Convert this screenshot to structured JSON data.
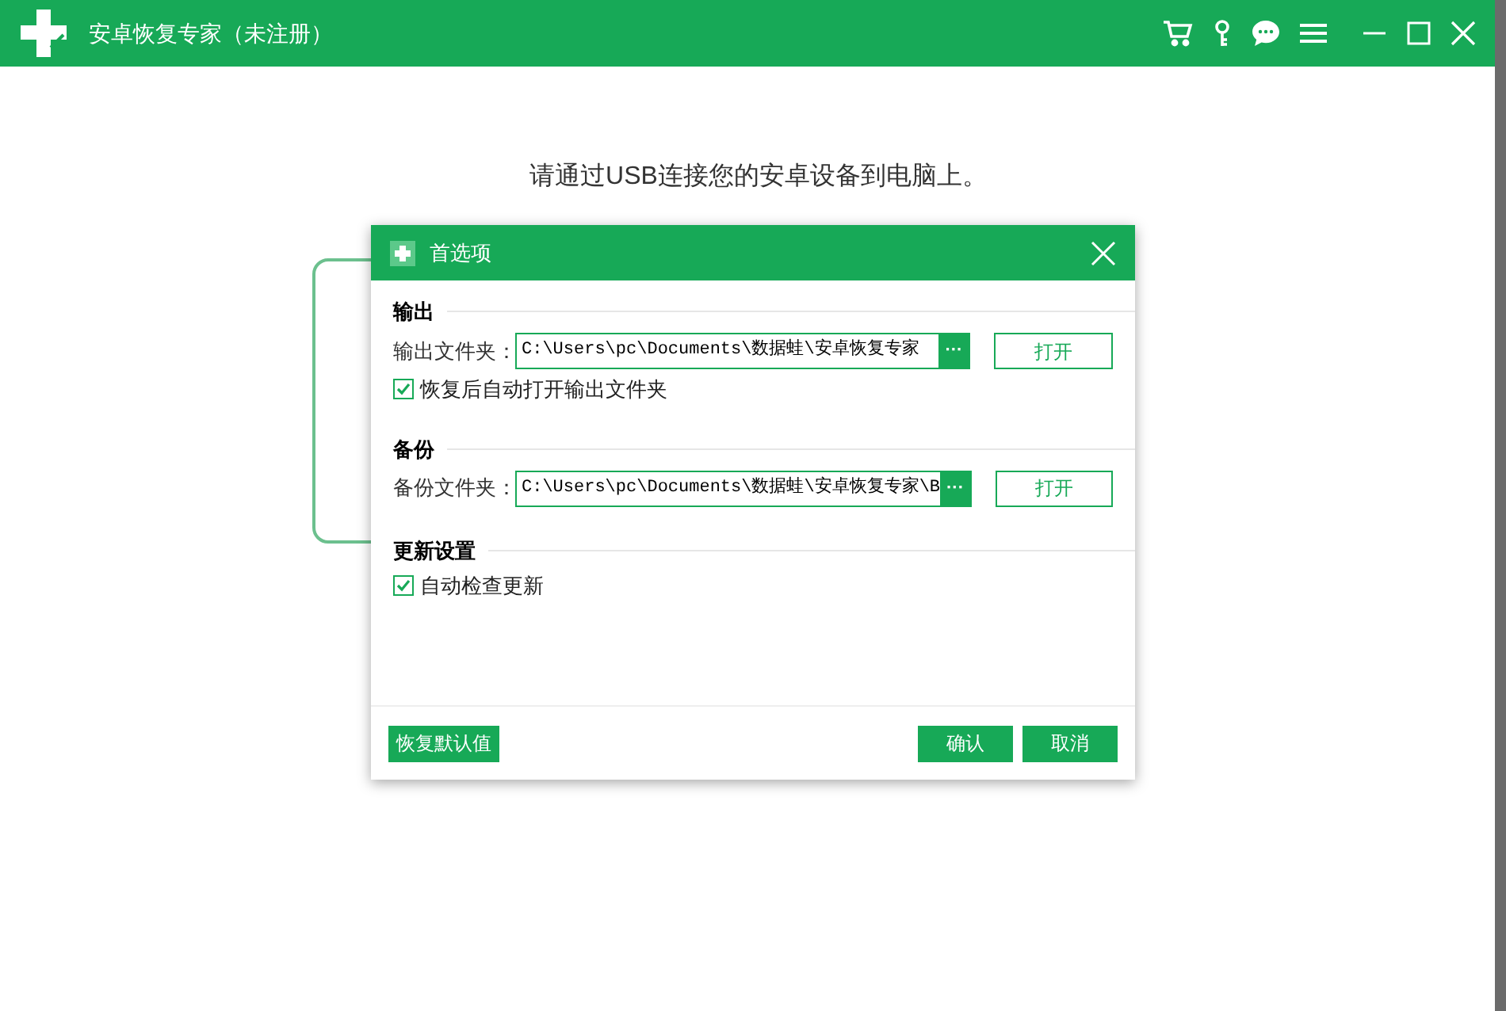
{
  "window": {
    "title": "安卓恢复专家（未注册）"
  },
  "main": {
    "prompt": "请通过USB连接您的安卓设备到电脑上。"
  },
  "dialog": {
    "title": "首选项",
    "sections": [
      {
        "heading": "输出",
        "items": [
          {
            "kind": "folder",
            "label": "输出文件夹：",
            "value": "C:\\Users\\pc\\Documents\\数据蛙\\安卓恢复专家",
            "browse": "···",
            "open": "打开"
          },
          {
            "kind": "checkbox",
            "label": "恢复后自动打开输出文件夹",
            "checked": true
          }
        ]
      },
      {
        "heading": "备份",
        "items": [
          {
            "kind": "folder",
            "label": "备份文件夹：",
            "value": "C:\\Users\\pc\\Documents\\数据蛙\\安卓恢复专家\\B",
            "browse": "···",
            "open": "打开"
          }
        ]
      },
      {
        "heading": "更新设置",
        "items": [
          {
            "kind": "checkbox",
            "label": "自动检查更新",
            "checked": true
          }
        ]
      }
    ],
    "buttons": {
      "reset": "恢复默认值",
      "ok": "确认",
      "cancel": "取消"
    }
  }
}
